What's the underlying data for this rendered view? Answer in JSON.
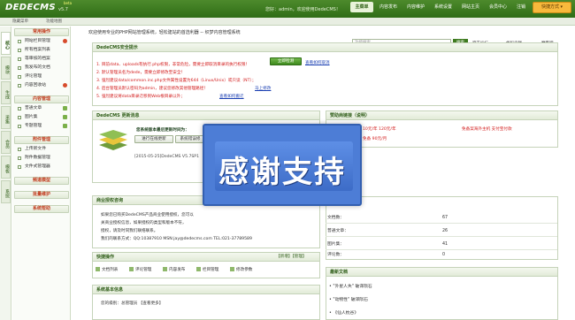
{
  "header": {
    "logo": "DEDECMS",
    "version": "v5.7",
    "badge": "beta",
    "welcome": "您好：admin，欢迎使用DedeCMS！",
    "nav": [
      "主菜单",
      "内容发布",
      "内容维护",
      "系统设置",
      "网站主页",
      "会员中心",
      "注销"
    ],
    "quick_mode": "快捷方式 ▾"
  },
  "subbar": {
    "hide_menu": "隐藏菜单",
    "quick_map": "功能地图"
  },
  "side_tabs": [
    "核心",
    "模块",
    "生成",
    "采集",
    "会员",
    "模板",
    "系统"
  ],
  "sidebar": {
    "sections": [
      {
        "title": "常用操作",
        "items": [
          {
            "label": "网站栏目管理",
            "mark": "plus"
          },
          {
            "label": "所有档案列表",
            "mark": ""
          },
          {
            "label": "等审核的档案",
            "mark": ""
          },
          {
            "label": "我发布的文档",
            "mark": ""
          },
          {
            "label": "评论管理",
            "mark": ""
          },
          {
            "label": "内容回收站",
            "mark": "plus"
          }
        ]
      },
      {
        "title": "内容管理",
        "items": [
          {
            "label": "普通文章",
            "mark": "pic"
          },
          {
            "label": "图片集",
            "mark": "pic"
          },
          {
            "label": "专题管理",
            "mark": "pic"
          }
        ]
      },
      {
        "title": "附件管理",
        "items": [
          {
            "label": "上传新文件",
            "mark": ""
          },
          {
            "label": "附件数据管理",
            "mark": ""
          },
          {
            "label": "文件式管理器",
            "mark": ""
          }
        ]
      },
      {
        "title": "频道模型",
        "items": []
      },
      {
        "title": "批量维护",
        "items": []
      },
      {
        "title": "系统帮助",
        "items": []
      }
    ]
  },
  "breadcrumb": "欢迎使用专业的PHP网站管理系统，轻松建站的首选利器 -- 织梦内容管理系统",
  "search": {
    "placeholder": "功能搜索",
    "button": "搜索"
  },
  "top_links": [
    "官方论坛",
    "代码贡献",
    "魔客吧"
  ],
  "security_panel": {
    "title": "DedeCMS安全提示",
    "lines": [
      "1. 目前data、uploads有执行.php权限，非常危险，需要立即取消目录的执行权限！",
      "2. 默认管理员名为dede，需要立即修改至安全！",
      "3. 强烈建议data/common.inc.php文件属性设置为644（Linux/Unix）或只读（NT）；",
      "4. 后台管理员默认密码为admin，建议您修改其他管理路径！",
      "5. 强烈建议将data目录迁移到Web根目录以外；"
    ],
    "links": [
      "查看如何取消",
      "马上修改",
      "查看如何搬迁"
    ],
    "button": "立即检测"
  },
  "update_panel": {
    "title": "DedeCMS 更新消息",
    "message": "您系统版本最后更新时间为：",
    "check_button": "进行在线更新",
    "sys_button": "系统错误修",
    "date_line": "[2015-05-25]DedeCMS V5.7SP1"
  },
  "license_panel": {
    "title": "商业授权咨询",
    "lines": [
      "如果您已购买DedeCMS产品商业使用授权，您可以",
      "关商业授权信息，如果授权的类型和版本不符，",
      "授权，请及时同我们联络联系。",
      "我们的联系方式：QQ:10387910 MSN:jay@dedecms.com TEL:021-37789589"
    ]
  },
  "quick_ops": {
    "title": "快捷操作",
    "right": "【新增】【管理】",
    "items": [
      "文档列表",
      "评论管理",
      "内容发布",
      "栏目管理",
      "修改参数"
    ]
  },
  "sysinfo": {
    "title": "系统基本信息",
    "line": "您的级别：总管理员 【查看更多】"
  },
  "sponsor": {
    "title": "赞助商链接（说明）",
    "left": [
      "10元/年 120元/年",
      "免备 90元/月"
    ],
    "right": "免备案海外主机 支付宝付款"
  },
  "stats": {
    "rows": [
      {
        "k": "文档数：",
        "v": "67"
      },
      {
        "k": "普通文章：",
        "v": "26"
      },
      {
        "k": "图片集：",
        "v": "41"
      },
      {
        "k": "评论数：",
        "v": "0"
      }
    ]
  },
  "latest": {
    "title": "最新文档",
    "items": [
      "\"外星人失\" 破译陨石",
      "\"动物性\" 破译陨石",
      "《仙人枕谷》"
    ]
  },
  "overlay": {
    "text": "感谢支持"
  }
}
